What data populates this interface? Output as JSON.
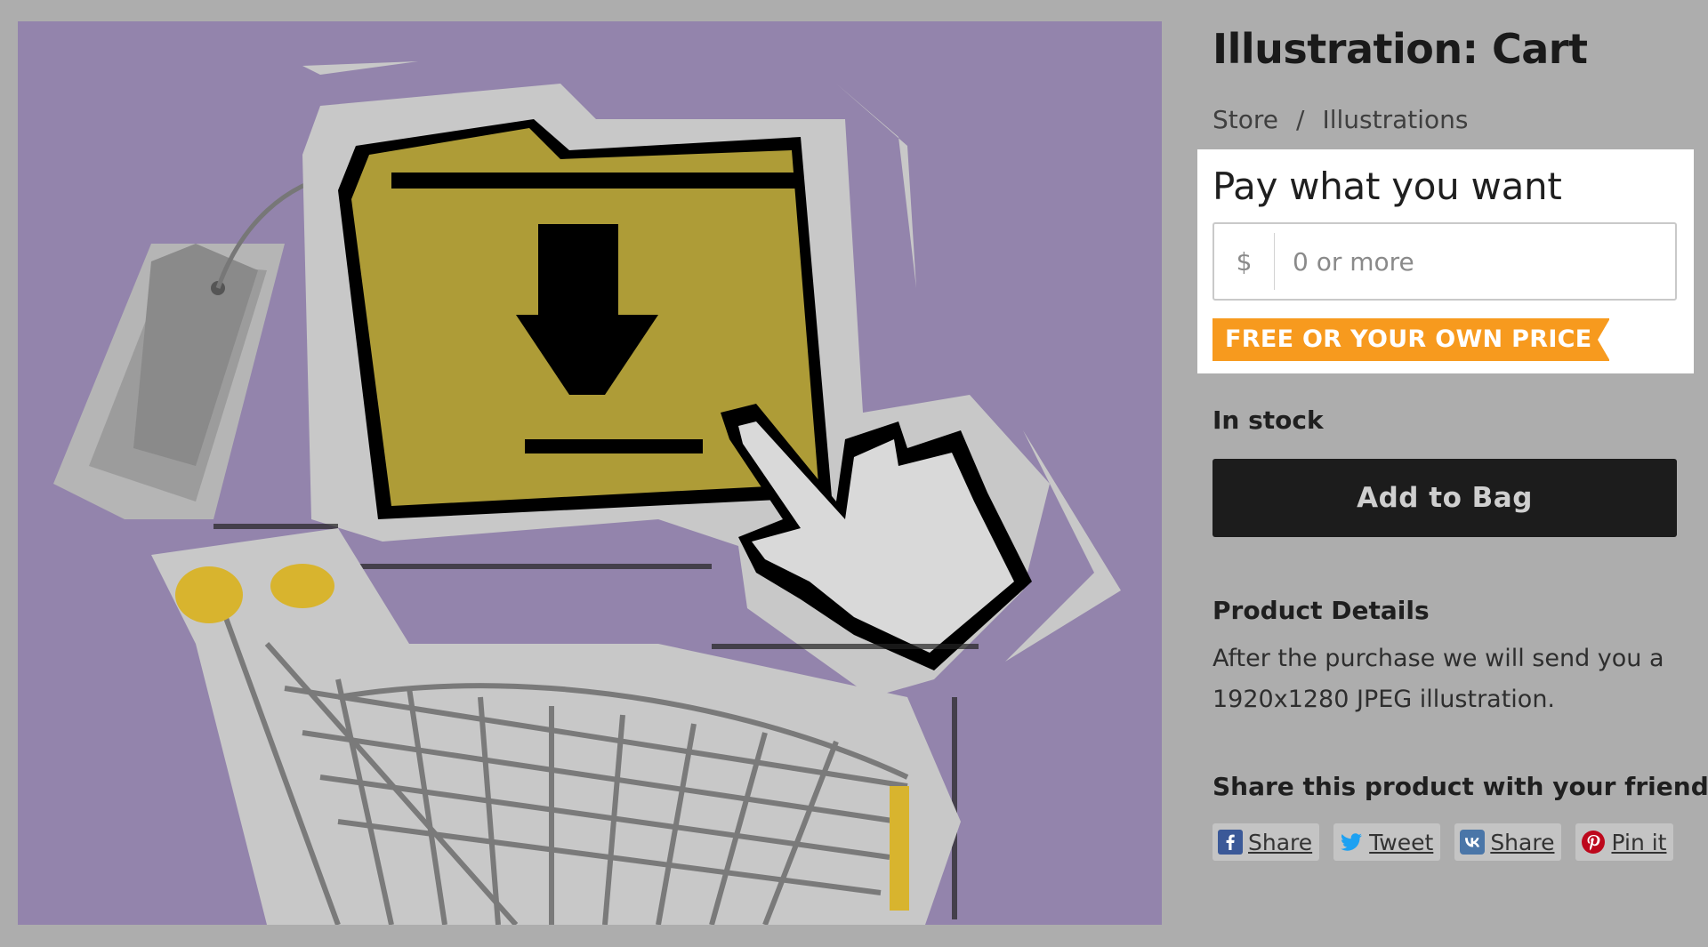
{
  "product": {
    "title": "Illustration: Cart",
    "breadcrumb": [
      "Store",
      "/",
      "Illustrations"
    ],
    "image_alt": "Illustration of a pixel folder with download arrow, pointing hand cursor, price tags and shopping cart",
    "pay_what_you_want": {
      "label": "Pay what you want",
      "currency": "$",
      "placeholder": "0 or more",
      "value": "",
      "badge": "FREE OR YOUR OWN PRICE",
      "badge_color": "#f79a1e"
    },
    "stock_status": "In stock",
    "add_to_bag_label": "Add to Bag",
    "details_heading": "Product Details",
    "details_text": "After the purchase we will send you a 1920x1280 JPEG illustration.",
    "share_heading": "Share this product with your friends",
    "share_buttons": [
      {
        "label": "Share",
        "icon": "facebook-icon",
        "color": "#3b5998"
      },
      {
        "label": "Tweet",
        "icon": "twitter-icon",
        "color": "#1da1f2"
      },
      {
        "label": "Share",
        "icon": "vk-icon",
        "color": "#4a76a8"
      },
      {
        "label": "Pin it",
        "icon": "pinterest-icon",
        "color": "#bd081c"
      }
    ]
  }
}
